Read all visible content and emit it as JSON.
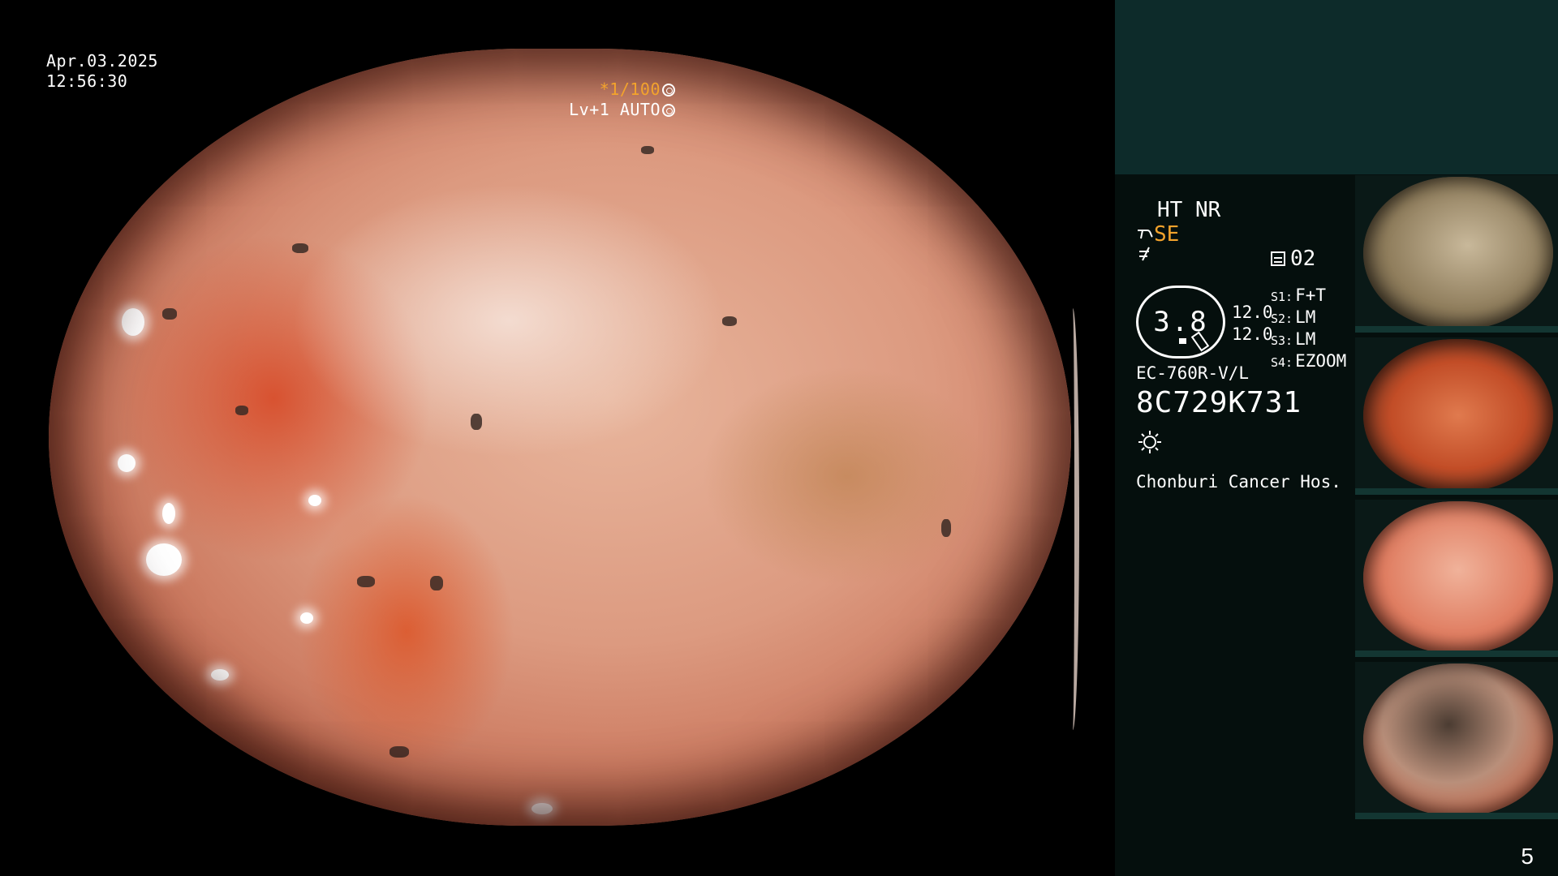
{
  "overlay": {
    "date": "Apr.03.2025",
    "time": "12:56:30",
    "shutter": "*1/100",
    "enhance": "Lv+1 AUTO"
  },
  "info": {
    "mode": "HT NR",
    "se": "SE",
    "memory": "02",
    "gauge_value": "3.8",
    "gauge_val_1": "12.0",
    "gauge_val_2": "12.0",
    "settings": [
      {
        "key": "S1:",
        "value": "F+T"
      },
      {
        "key": "S2:",
        "value": "LM"
      },
      {
        "key": "S3:",
        "value": "LM"
      },
      {
        "key": "S4:",
        "value": "EZOOM"
      }
    ],
    "scope_model": "EC-760R-V/L",
    "serial": "8C729K731",
    "hospital": "Chonburi Cancer Hos."
  },
  "page_number": "5",
  "icons": [
    "aperture-icon",
    "auto-iris-icon",
    "structure-enhance-icon",
    "color-mode-icon",
    "memory-icon",
    "light-icon"
  ]
}
